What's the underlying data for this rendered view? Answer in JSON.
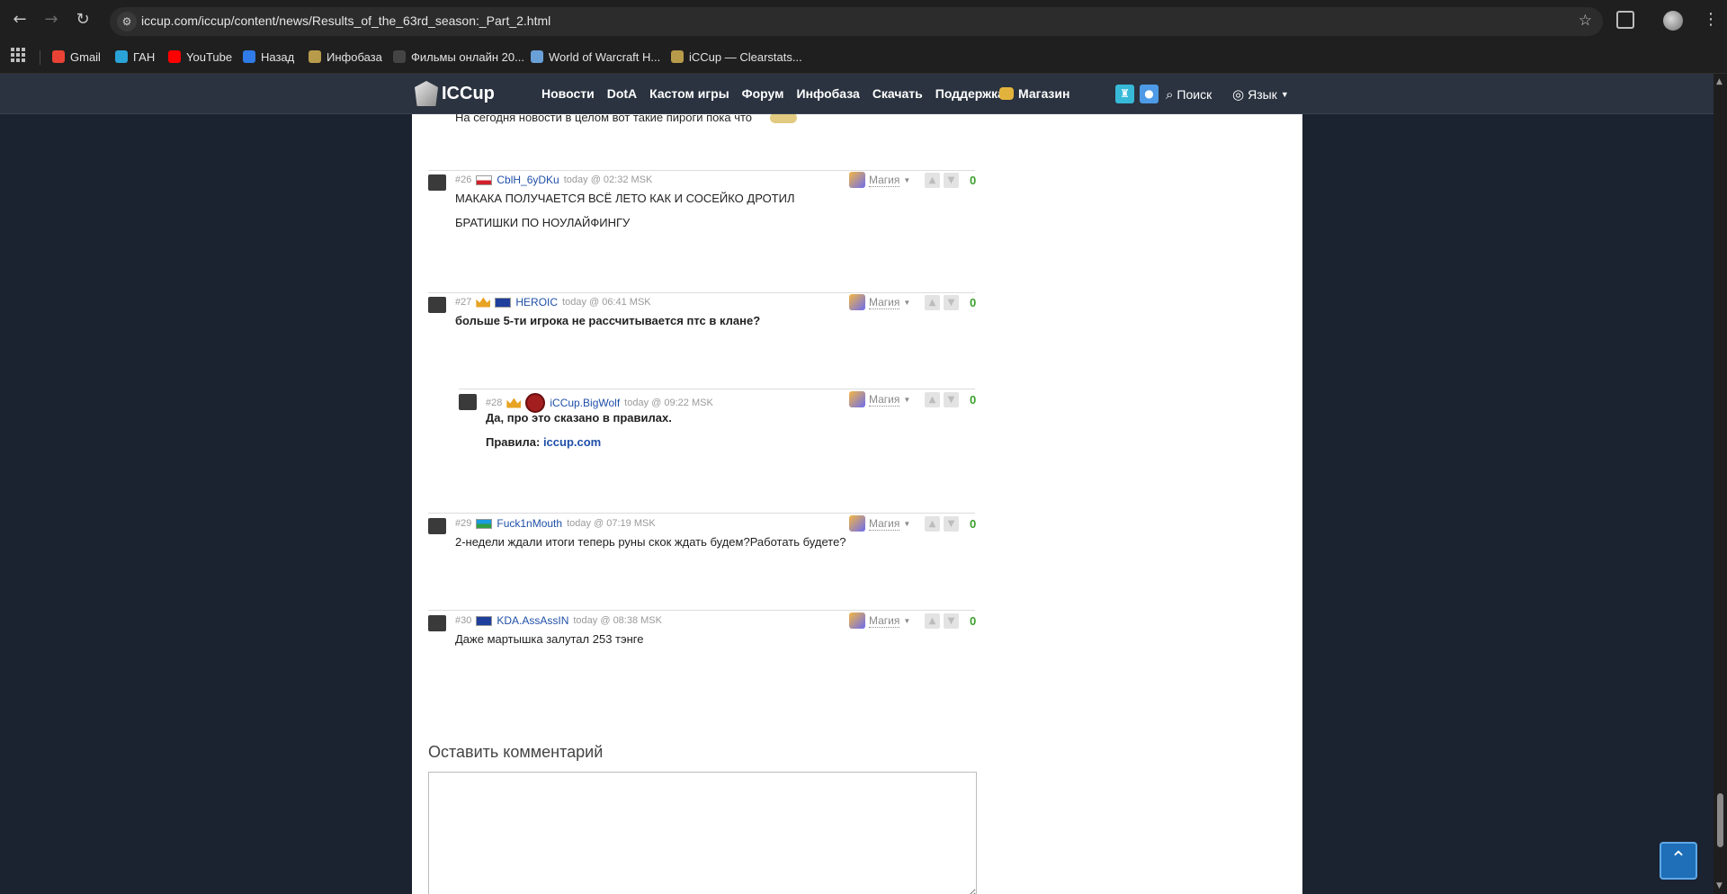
{
  "browser": {
    "url": "iccup.com/iccup/content/news/Results_of_the_63rd_season:_Part_2.html",
    "back_glyph": "←",
    "forward_glyph": "→",
    "reload_glyph": "↻",
    "bookmarks": [
      {
        "label": "Gmail",
        "icon": "gmail-icon",
        "color": "#ea4335"
      },
      {
        "label": "ГАН",
        "icon": "gan-icon",
        "color": "#2aa3d8"
      },
      {
        "label": "YouTube",
        "icon": "youtube-icon",
        "color": "#ff0000"
      },
      {
        "label": "Назад",
        "icon": "chat-icon",
        "color": "#2f7be7"
      },
      {
        "label": "Инфобаза",
        "icon": "iccup-icon",
        "color": "#b89b4a"
      },
      {
        "label": "Фильмы онлайн 20...",
        "icon": "film-icon",
        "color": "#444444"
      },
      {
        "label": "World of Warcraft H...",
        "icon": "wow-icon",
        "color": "#6aa0d8"
      },
      {
        "label": "iCCup — Clearstats...",
        "icon": "iccup-icon",
        "color": "#b89b4a"
      }
    ]
  },
  "site_header": {
    "logo_text": "ICCup",
    "nav": [
      "Новости",
      "DotA",
      "Кастом игры",
      "Форум",
      "Инфобаза",
      "Скачать",
      "Поддержка"
    ],
    "shop": "Магазин",
    "search": "Поиск",
    "language": "Язык"
  },
  "partial_text": "На сегодня новости в целом вот такие пироги пока что",
  "comments": [
    {
      "num": "#26",
      "flag_colors": [
        "#ffffff",
        "#d21f2b"
      ],
      "crown": false,
      "clan_badge": false,
      "user": "CblH_6yDKu",
      "time": "today @ 02:32 MSK",
      "lines": [
        "МАКАКА ПОЛУЧАЕТСЯ ВСЁ ЛЕТО КАК И СОСЕЙКО ДРОТИЛ",
        "БРАТИШКИ ПО НОУЛАЙФИНГУ"
      ],
      "bold": false,
      "magic": "Магия",
      "score": "0"
    },
    {
      "num": "#27",
      "flag_colors": [
        "#1f3f9c",
        "#1f3f9c"
      ],
      "crown": true,
      "clan_badge": false,
      "user": "HEROIC",
      "time": "today @ 06:41 MSK",
      "lines": [
        "больше 5-ти игрока не рассчитывается птс в клане?"
      ],
      "bold": true,
      "magic": "Магия",
      "score": "0"
    },
    {
      "num": "#28",
      "flag_colors": [],
      "crown": true,
      "clan_badge": true,
      "user": "iCCup.BigWolf",
      "time": "today @ 09:22 MSK",
      "lines": [
        "Да, про это сказано в правилах."
      ],
      "rules_prefix": "Правила: ",
      "rules_link": "iccup.com",
      "bold": true,
      "magic": "Магия",
      "score": "0"
    },
    {
      "num": "#29",
      "flag_colors": [
        "#1a9be0",
        "#2f9e44"
      ],
      "crown": false,
      "clan_badge": false,
      "user": "Fuck1nMouth",
      "time": "today @ 07:19 MSK",
      "lines": [
        "2-недели ждали итоги теперь руны скок ждать будем?Работать будете?"
      ],
      "bold": false,
      "magic": "Магия",
      "score": "0"
    },
    {
      "num": "#30",
      "flag_colors": [
        "#1f3f9c",
        "#1f3f9c"
      ],
      "crown": false,
      "clan_badge": false,
      "user": "KDA.AssAssIN",
      "time": "today @ 08:38 MSK",
      "lines": [
        "Даже мартышка залутал 253 тэнге"
      ],
      "bold": false,
      "magic": "Магия",
      "score": "0"
    }
  ],
  "leave_comment_title": "Оставить комментарий",
  "to_top_glyph": "⌃"
}
